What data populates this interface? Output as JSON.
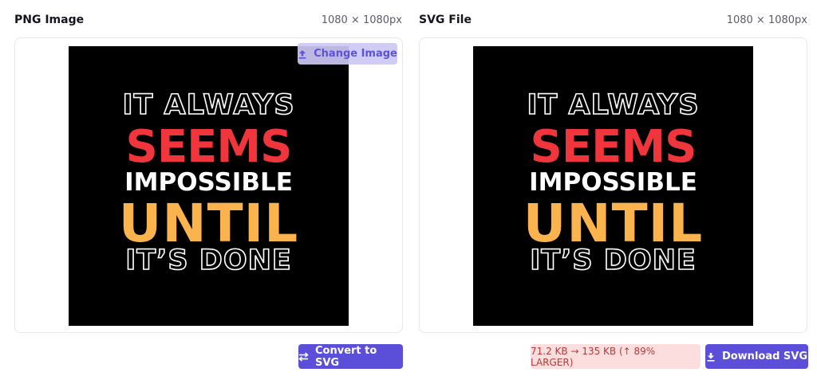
{
  "left_panel": {
    "title": "PNG Image",
    "dimensions": "1080 × 1080px",
    "change_button_label": "Change Image",
    "convert_button_label": "Convert to SVG"
  },
  "right_panel": {
    "title": "SVG File",
    "dimensions": "1080 × 1080px",
    "size_badge": "71.2 KB → 135 KB (↑ 89% LARGER)",
    "download_button_label": "Download SVG"
  },
  "artwork": {
    "line1": "IT ALWAYS",
    "line2": "SEEMS",
    "line3": "IMPOSSIBLE",
    "line4": "UNTIL",
    "line5": "IT’S DONE"
  },
  "colors": {
    "accent": "#5b4fd9",
    "art_red": "#f0353d",
    "art_yellow": "#fbb34e",
    "badge_bg": "#fcdede",
    "badge_text": "#b73a3a"
  },
  "icons": {
    "change": "upload-icon",
    "convert": "swap-arrows-icon",
    "download": "download-icon"
  }
}
